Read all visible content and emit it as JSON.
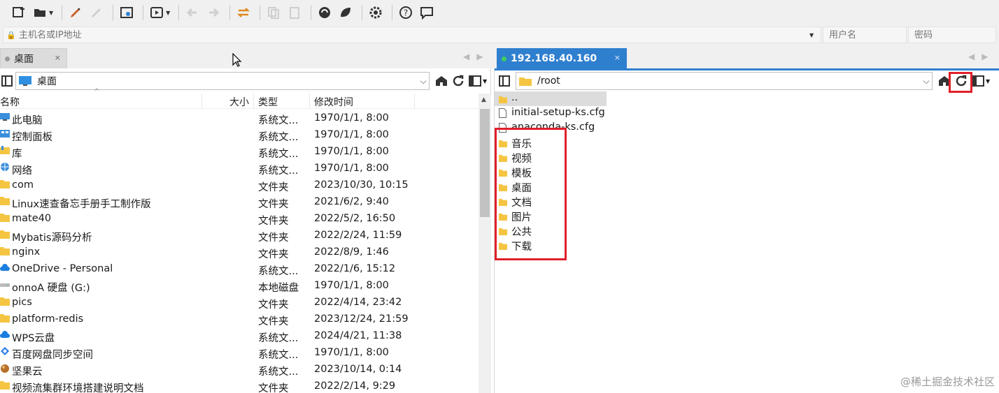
{
  "toolbar": {
    "icons": [
      "new-session-icon",
      "open-folder-icon",
      "edit-icon",
      "disconnect-icon",
      "settings-icon",
      "play-icon",
      "back-arrow-icon",
      "forward-arrow-icon",
      "transfer-icon",
      "copy-icon",
      "paste-icon",
      "ssh-icon",
      "console-icon",
      "gear-icon",
      "help-icon",
      "chat-icon"
    ]
  },
  "address_bar": {
    "host_placeholder": "主机名或IP地址",
    "user_placeholder": "用户名",
    "password_placeholder": "密码"
  },
  "left_panel": {
    "tab_label": "桌面",
    "tab_close": "×",
    "path": "桌面",
    "columns": {
      "name": "名称",
      "size": "大小",
      "type": "类型",
      "modified": "修改时间"
    },
    "rows": [
      {
        "name": "此电脑",
        "type": "系统文...",
        "date": "1970/1/1, 8:00",
        "icon": "computer-icon"
      },
      {
        "name": "控制面板",
        "type": "系统文...",
        "date": "1970/1/1, 8:00",
        "icon": "control-panel-icon"
      },
      {
        "name": "库",
        "type": "系统文...",
        "date": "1970/1/1, 8:00",
        "icon": "library-icon"
      },
      {
        "name": "网络",
        "type": "系统文...",
        "date": "1970/1/1, 8:00",
        "icon": "network-icon"
      },
      {
        "name": "com",
        "type": "文件夹",
        "date": "2023/10/30, 10:15",
        "icon": "folder-icon"
      },
      {
        "name": "Linux速查备忘手册手工制作版",
        "type": "文件夹",
        "date": "2021/6/2, 9:40",
        "icon": "folder-icon"
      },
      {
        "name": "mate40",
        "type": "文件夹",
        "date": "2022/5/2, 16:50",
        "icon": "folder-icon"
      },
      {
        "name": "Mybatis源码分析",
        "type": "文件夹",
        "date": "2022/2/24, 11:59",
        "icon": "folder-icon"
      },
      {
        "name": "nginx",
        "type": "文件夹",
        "date": "2022/8/9, 1:46",
        "icon": "folder-icon"
      },
      {
        "name": "OneDrive - Personal",
        "type": "系统文...",
        "date": "2022/1/6, 15:12",
        "icon": "cloud-icon"
      },
      {
        "name": "onnoA 硬盘 (G:)",
        "type": "本地磁盘",
        "date": "1970/1/1, 8:00",
        "icon": "drive-icon"
      },
      {
        "name": "pics",
        "type": "文件夹",
        "date": "2022/4/14, 23:42",
        "icon": "folder-icon"
      },
      {
        "name": "platform-redis",
        "type": "文件夹",
        "date": "2023/12/24, 21:59",
        "icon": "folder-icon"
      },
      {
        "name": "WPS云盘",
        "type": "系统文...",
        "date": "2024/4/21, 11:38",
        "icon": "cloud-icon"
      },
      {
        "name": "百度网盘同步空间",
        "type": "系统文...",
        "date": "1970/1/1, 8:00",
        "icon": "baidu-icon"
      },
      {
        "name": "坚果云",
        "type": "系统文...",
        "date": "2023/10/14, 0:14",
        "icon": "nut-cloud-icon"
      },
      {
        "name": "视频流集群环境搭建说明文档",
        "type": "文件夹",
        "date": "2022/2/14, 9:29",
        "icon": "folder-icon"
      }
    ]
  },
  "right_panel": {
    "tab_label": "192.168.40.160",
    "tab_close": "×",
    "path": "/root",
    "rows": [
      {
        "name": "..",
        "icon": "folder-icon"
      },
      {
        "name": "initial-setup-ks.cfg",
        "icon": "file-icon"
      },
      {
        "name": "anaconda-ks.cfg",
        "icon": "file-icon"
      },
      {
        "name": "音乐",
        "icon": "folder-icon"
      },
      {
        "name": "视频",
        "icon": "folder-icon"
      },
      {
        "name": "模板",
        "icon": "folder-icon"
      },
      {
        "name": "桌面",
        "icon": "folder-icon"
      },
      {
        "name": "文档",
        "icon": "folder-icon"
      },
      {
        "name": "图片",
        "icon": "folder-icon"
      },
      {
        "name": "公共",
        "icon": "folder-icon"
      },
      {
        "name": "下载",
        "icon": "folder-icon"
      }
    ]
  },
  "watermark": "@稀土掘金技术社区",
  "colors": {
    "accent": "#2f7fcf",
    "highlight": "#e0202a",
    "folder": "#f5c542"
  }
}
